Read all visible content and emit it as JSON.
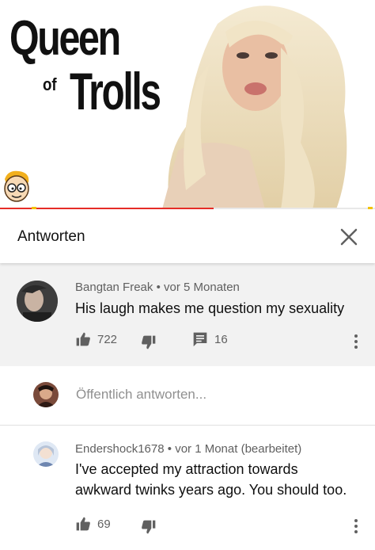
{
  "video": {
    "title_line1": "Queen",
    "title_line2a": "of",
    "title_line2b": "Trolls",
    "progress_fraction": 0.57,
    "colors": {
      "progress": "#e52d27",
      "marker": "#f2c200"
    }
  },
  "panel": {
    "title": "Antworten",
    "close_icon": "close-icon"
  },
  "parent_comment": {
    "author": "Bangtan Freak",
    "separator": "•",
    "time": "vor 5 Monaten",
    "text": "His laugh makes me question my sexuality",
    "likes": "722",
    "replies": "16"
  },
  "reply_input": {
    "placeholder": "Öffentlich antworten..."
  },
  "replies": [
    {
      "author": "Endershock1678",
      "separator": "•",
      "time": "vor 1 Monat (bearbeitet)",
      "text_line1": "I've accepted my attraction towards",
      "text_line2": "awkward twinks years ago. You should too.",
      "likes": "69"
    }
  ]
}
